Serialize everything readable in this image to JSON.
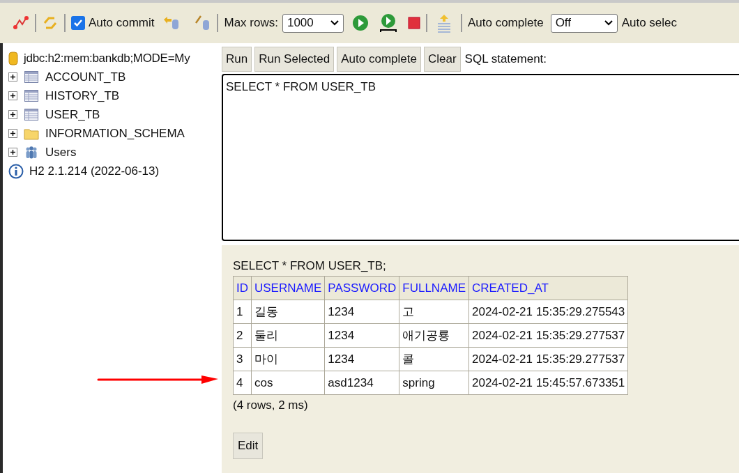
{
  "toolbar": {
    "auto_commit": {
      "label": "Auto commit",
      "checked": true
    },
    "max_rows": {
      "label": "Max rows:",
      "value": "1000"
    },
    "auto_complete": {
      "label": "Auto complete",
      "value": "Off"
    },
    "auto_select": {
      "label": "Auto selec"
    }
  },
  "tree": {
    "connection": "jdbc:h2:mem:bankdb;MODE=My",
    "items": [
      {
        "kind": "table",
        "label": "ACCOUNT_TB",
        "expanded": false
      },
      {
        "kind": "table",
        "label": "HISTORY_TB",
        "expanded": false
      },
      {
        "kind": "table",
        "label": "USER_TB",
        "expanded": false
      },
      {
        "kind": "folder",
        "label": "INFORMATION_SCHEMA",
        "expanded": false
      },
      {
        "kind": "users",
        "label": "Users",
        "expanded": false
      }
    ],
    "version": "H2 2.1.214 (2022-06-13)"
  },
  "editor": {
    "buttons": [
      "Run",
      "Run Selected",
      "Auto complete",
      "Clear"
    ],
    "label": "SQL statement:",
    "value": "SELECT * FROM USER_TB"
  },
  "result": {
    "query": "SELECT * FROM USER_TB;",
    "columns": [
      "ID",
      "USERNAME",
      "PASSWORD",
      "FULLNAME",
      "CREATED_AT"
    ],
    "rows": [
      [
        "1",
        "길동",
        "1234",
        "고",
        "2024-02-21 15:35:29.275543"
      ],
      [
        "2",
        "둘리",
        "1234",
        "애기공룡",
        "2024-02-21 15:35:29.277537"
      ],
      [
        "3",
        "마이",
        "1234",
        "콜",
        "2024-02-21 15:35:29.277537"
      ],
      [
        "4",
        "cos",
        "asd1234",
        "spring",
        "2024-02-21 15:45:57.673351"
      ]
    ],
    "summary": "(4 rows, 2 ms)",
    "edit_button": "Edit"
  }
}
